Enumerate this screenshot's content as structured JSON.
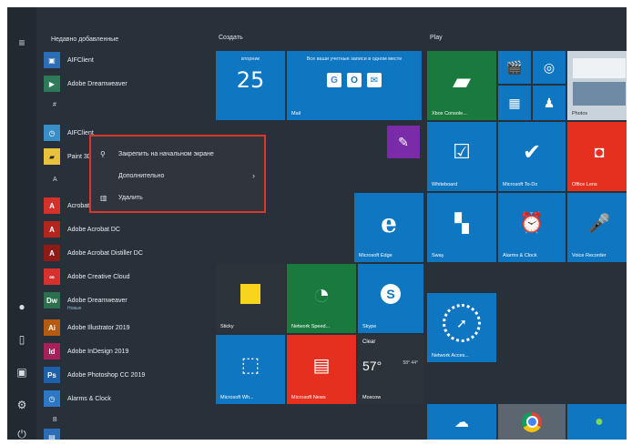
{
  "rail": {
    "icons": [
      "menu-icon",
      "user-icon",
      "document-icon",
      "picture-icon",
      "settings-icon",
      "power-icon"
    ]
  },
  "applist": {
    "recent_header": "Недавно добавленные",
    "items": [
      {
        "label": "AIFClient",
        "color": "#2d6db5"
      },
      {
        "label": "Adobe Dreamweaver",
        "color": "#2c7a58"
      },
      {
        "label": "AIFClient",
        "color": "#3a8ec7",
        "glyph": "◷"
      },
      {
        "label": "Paint 3D",
        "color": "#e8c23a"
      },
      {
        "label": "Acrobat",
        "color": "#d4312a"
      },
      {
        "label": "Adobe Acrobat DC",
        "color": "#b3251f"
      },
      {
        "label": "Adobe Acrobat Distiller DC",
        "color": "#8f1b18"
      },
      {
        "label": "Adobe Creative Cloud",
        "color": "#d8302c"
      },
      {
        "label": "Adobe Dreamweaver",
        "color": "#2b6f4f",
        "sub": "Новые"
      },
      {
        "label": "Adobe Illustrator 2019",
        "color": "#b55a10"
      },
      {
        "label": "Adobe InDesign 2019",
        "color": "#a8205a"
      },
      {
        "label": "Adobe Photoshop CC 2019",
        "color": "#1e5fa8"
      },
      {
        "label": "Alarms & Clock",
        "color": "#2d78c4",
        "glyph": "◷"
      }
    ],
    "letters": [
      "#",
      "A",
      "B"
    ]
  },
  "context_menu": {
    "items": [
      {
        "label": "Закрепить на начальном экране",
        "icon": "pin-icon",
        "glyph": "⚲"
      },
      {
        "label": "Дополнительно",
        "icon": "more-icon",
        "glyph": "",
        "chevron": "›"
      },
      {
        "label": "Удалить",
        "icon": "trash-icon",
        "glyph": "🗑"
      }
    ]
  },
  "groups": {
    "left": "Создать",
    "right": "Play"
  },
  "tiles": {
    "calendar": {
      "day": "вторник",
      "num": "25",
      "label": ""
    },
    "mail": {
      "top": "Все ваши учетные записи в одном месте",
      "label": "Mail"
    },
    "purple": {
      "label": ""
    },
    "xbox": {
      "label": "Xbox Console..."
    },
    "movies": {
      "label": ""
    },
    "groove": {
      "label": ""
    },
    "photos": {
      "label": ""
    },
    "calc": {
      "label": ""
    },
    "people": {
      "label": ""
    },
    "screenshot": {
      "label": "Photos"
    },
    "whiteboard": {
      "label": "Whiteboard"
    },
    "todo": {
      "label": "Microsoft To-Do"
    },
    "office": {
      "label": "Office Lens"
    },
    "edge": {
      "label": "Microsoft Edge"
    },
    "sway": {
      "label": "Sway"
    },
    "alarms": {
      "label": "Alarms & Clock"
    },
    "voice": {
      "label": "Voice Recorder"
    },
    "sticky": {
      "label": "Sticky"
    },
    "speedtest": {
      "label": "Network Speed..."
    },
    "skype": {
      "label": "Skype"
    },
    "netspeed": {
      "label": "Network Acces..."
    },
    "whiteboard2": {
      "label": "Microsoft Wh..."
    },
    "news": {
      "label": "Microsoft News"
    },
    "weather": {
      "top": "Clear",
      "deg": "57°",
      "side": "58°\n44°",
      "label": "Moscow"
    },
    "bottom1": {
      "label": ""
    },
    "bottom2": {
      "label": ""
    },
    "bottom3": {
      "label": ""
    }
  },
  "colors": {
    "background": "#28313a",
    "tile_blue": "#0f76c2",
    "tile_green": "#1a7a3e",
    "tile_red": "#e5301f",
    "tile_purple": "#7a2ba8",
    "tile_dark": "#2c333a",
    "menu_border": "#d9362e"
  }
}
